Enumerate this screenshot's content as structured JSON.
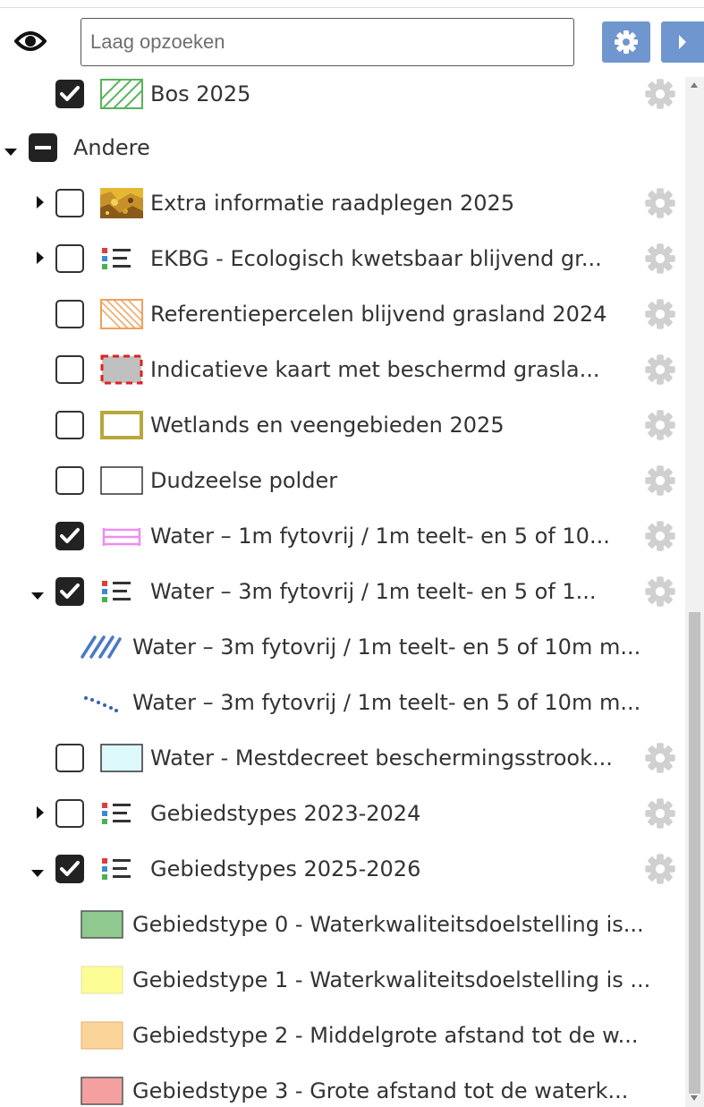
{
  "search": {
    "placeholder": "Laag opzoeken"
  },
  "icons": {
    "visibility": "eye-icon",
    "settings_button": "gear-icon",
    "expand_button": "chevron-right-icon",
    "layer_settings": "gear-icon"
  },
  "colors": {
    "accent": "#6f96cf",
    "checkbox": "#222222",
    "text": "#333333",
    "settings_cog": "#d0d0d0"
  },
  "layers": [
    {
      "label": "Bos 2025",
      "checkbox": "checked",
      "expander": "none",
      "symbol": "hatch-green",
      "settings": true
    },
    {
      "label": "Andere",
      "checkbox": "indeterminate",
      "expander": "expanded",
      "symbol": "none",
      "settings": false
    },
    {
      "label": "Extra informatie raadplegen 2025",
      "checkbox": "unchecked",
      "expander": "collapsed",
      "symbol": "raster-thumbnail",
      "settings": true
    },
    {
      "label": "EKBG - Ecologisch kwetsbaar blijvend gr...",
      "checkbox": "unchecked",
      "expander": "collapsed",
      "symbol": "legend-list",
      "settings": true
    },
    {
      "label": "Referentiepercelen blijvend grasland 2024",
      "checkbox": "unchecked",
      "expander": "none",
      "symbol": "hatch-orange",
      "settings": true
    },
    {
      "label": "Indicatieve kaart met beschermd grasla...",
      "checkbox": "unchecked",
      "expander": "none",
      "symbol": "dashed-red-grey",
      "settings": true
    },
    {
      "label": "Wetlands en veengebieden 2025",
      "checkbox": "unchecked",
      "expander": "none",
      "symbol": "olive-outline",
      "settings": true
    },
    {
      "label": "Dudzeelse polder",
      "checkbox": "unchecked",
      "expander": "none",
      "symbol": "black-outline",
      "settings": true
    },
    {
      "label": "Water – 1m fytovrij / 1m teelt- en 5 of 10...",
      "checkbox": "checked",
      "expander": "none",
      "symbol": "pink-lines",
      "settings": true
    },
    {
      "label": "Water – 3m fytovrij / 1m teelt- en 5 of 1...",
      "checkbox": "checked",
      "expander": "expanded",
      "symbol": "legend-list",
      "settings": true
    },
    {
      "label": "Water – 3m fytovrij / 1m teelt- en 5 of 10m m...",
      "checkbox": "none",
      "expander": "none",
      "symbol": "blue-diagonal-hatch",
      "settings": false
    },
    {
      "label": "Water – 3m fytovrij / 1m teelt- en 5 of 10m m...",
      "checkbox": "none",
      "expander": "none",
      "symbol": "blue-dotted-line",
      "settings": false
    },
    {
      "label": "Water - Mestdecreet beschermingsstrook...",
      "checkbox": "unchecked",
      "expander": "none",
      "symbol": "light-cyan-fill",
      "settings": true
    },
    {
      "label": "Gebiedstypes 2023-2024",
      "checkbox": "unchecked",
      "expander": "collapsed",
      "symbol": "legend-list",
      "settings": true
    },
    {
      "label": "Gebiedstypes 2025-2026",
      "checkbox": "checked",
      "expander": "expanded",
      "symbol": "legend-list",
      "settings": true
    },
    {
      "label": "Gebiedstype 0 - Waterkwaliteitsdoelstelling is...",
      "checkbox": "none",
      "expander": "none",
      "symbol": "fill-green",
      "settings": false
    },
    {
      "label": "Gebiedstype 1 - Waterkwaliteitsdoelstelling is ...",
      "checkbox": "none",
      "expander": "none",
      "symbol": "fill-yellow",
      "settings": false
    },
    {
      "label": "Gebiedstype 2 - Middelgrote afstand tot de w...",
      "checkbox": "none",
      "expander": "none",
      "symbol": "fill-orange",
      "settings": false
    },
    {
      "label": "Gebiedstype 3 - Grote afstand tot de waterk...",
      "checkbox": "none",
      "expander": "none",
      "symbol": "fill-red",
      "settings": false
    }
  ]
}
